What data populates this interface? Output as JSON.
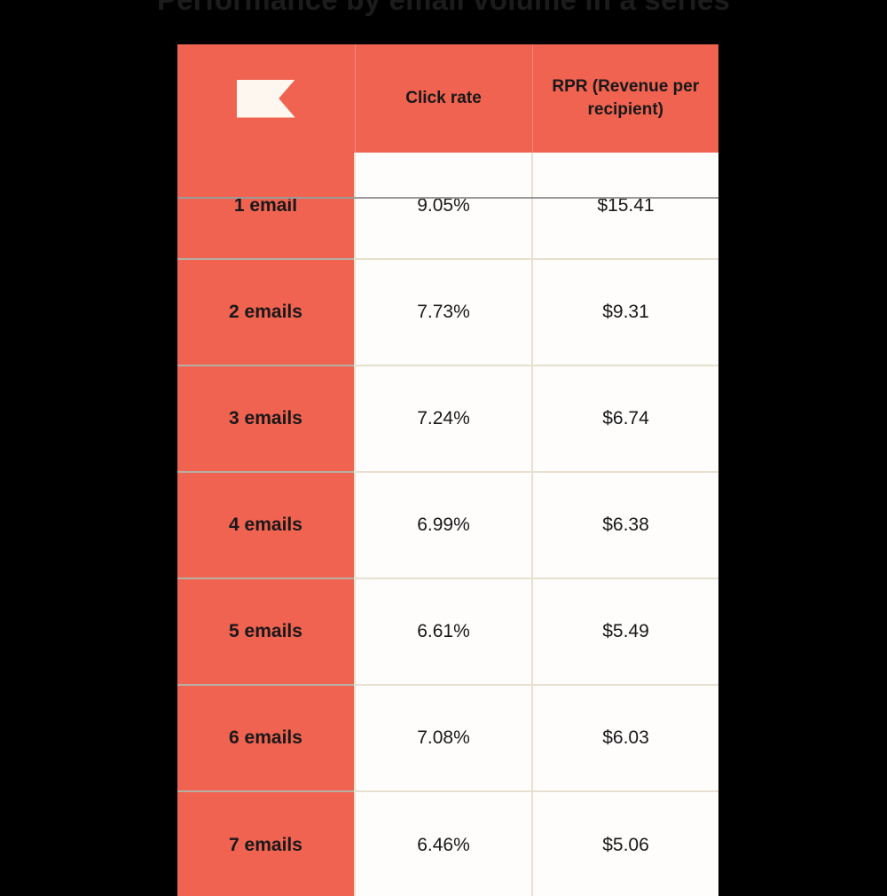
{
  "headline": {
    "text": "Performance by email volume in a series"
  },
  "table": {
    "header": {
      "icon": "flag-icon",
      "icon_color": "#FDF7EF",
      "columns": [
        "",
        "Click rate",
        "RPR (Revenue per recipient)"
      ]
    },
    "rows": [
      {
        "label": "1 email",
        "click_rate": "9.05%",
        "rpr": "$15.41"
      },
      {
        "label": "2 emails",
        "click_rate": "7.73%",
        "rpr": "$9.31"
      },
      {
        "label": "3 emails",
        "click_rate": "7.24%",
        "rpr": "$6.74"
      },
      {
        "label": "4 emails",
        "click_rate": "6.99%",
        "rpr": "$6.38"
      },
      {
        "label": "5 emails",
        "click_rate": "6.61%",
        "rpr": "$5.49"
      },
      {
        "label": "6 emails",
        "click_rate": "7.08%",
        "rpr": "$6.03"
      },
      {
        "label": "7 emails",
        "click_rate": "6.46%",
        "rpr": "$5.06"
      }
    ]
  },
  "colors": {
    "accent": "#EF6350",
    "background": "#000000",
    "cell_background": "#FEFDFB",
    "divider": "#E8E0CE",
    "text": "#18181A"
  },
  "chart_data": {
    "type": "table",
    "title": "Performance by email volume in a series",
    "categories": [
      "1 email",
      "2 emails",
      "3 emails",
      "4 emails",
      "5 emails",
      "6 emails",
      "7 emails"
    ],
    "series": [
      {
        "name": "Click rate",
        "values": [
          9.05,
          7.73,
          7.24,
          6.99,
          6.61,
          7.08,
          6.46
        ],
        "unit": "%"
      },
      {
        "name": "RPR (Revenue per recipient)",
        "values": [
          15.41,
          9.31,
          6.74,
          6.38,
          5.49,
          6.03,
          5.06
        ],
        "unit": "$"
      }
    ],
    "xlabel": "",
    "ylabel": "",
    "grid": true,
    "legend": "none"
  }
}
